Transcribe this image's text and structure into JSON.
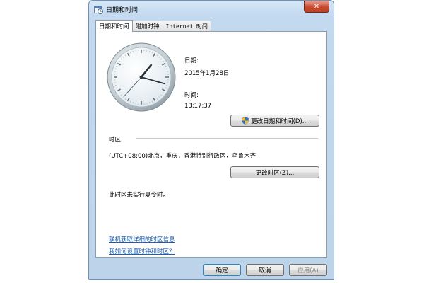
{
  "window": {
    "title": "日期和时间",
    "close_glyph": "✕"
  },
  "tabs": [
    {
      "label": "日期和时间",
      "active": true
    },
    {
      "label": "附加时钟",
      "active": false
    },
    {
      "label": "Internet 时间",
      "active": false
    }
  ],
  "datetime": {
    "date_label": "日期:",
    "date_value": "2015年1月28日",
    "time_label": "时间:",
    "time_value": "13:17:37",
    "change_button": "更改日期和时间(D)..."
  },
  "timezone": {
    "section_label": "时区",
    "value": "(UTC+08:00)北京，重庆，香港特别行政区，乌鲁木齐",
    "change_button": "更改时区(Z)...",
    "dst_note": "此时区未实行夏令时。"
  },
  "links": {
    "online_info": "联机获取详细的时区信息",
    "how_to": "我如何设置时钟和时区？"
  },
  "footer": {
    "ok": "确定",
    "cancel": "取消",
    "apply": "应用(A)"
  },
  "clock": {
    "hour": 13,
    "minute": 17,
    "second": 37
  },
  "icons": {
    "app": "calendar-clock-icon",
    "shield": "uac-shield-icon"
  },
  "colors": {
    "window_frame": "#bcd3ea",
    "close_button": "#c74a32",
    "link": "#1a5fb4"
  }
}
